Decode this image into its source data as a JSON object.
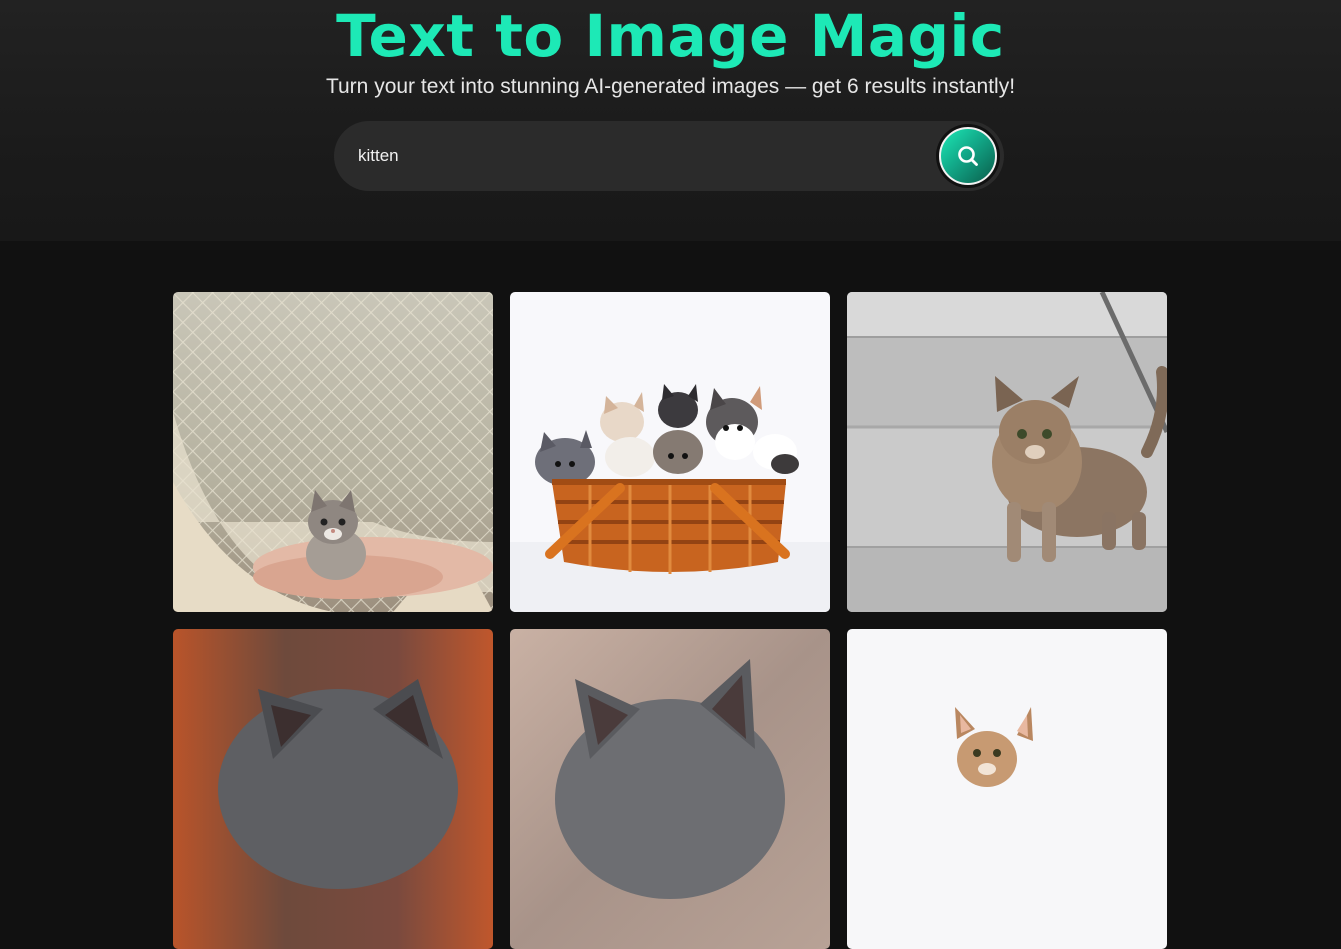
{
  "header": {
    "title": "Text to Image Magic",
    "subtitle": "Turn your text into stunning AI-generated images — get 6 results instantly!"
  },
  "search": {
    "value": "kitten",
    "button_icon": "search-icon"
  },
  "colors": {
    "accent": "#1de9b6",
    "background": "#111111",
    "hero_background": "#1e1e1e",
    "search_bg": "#2b2b2b"
  },
  "gallery": {
    "results": [
      {
        "subject": "kitten in a white rope hammock"
      },
      {
        "subject": "kittens in a wicker basket"
      },
      {
        "subject": "fluffy tabby kitten on stairs"
      },
      {
        "subject": "gray kitten from behind"
      },
      {
        "subject": "gray kitten ears close-up"
      },
      {
        "subject": "tabby kitten on white"
      }
    ]
  }
}
